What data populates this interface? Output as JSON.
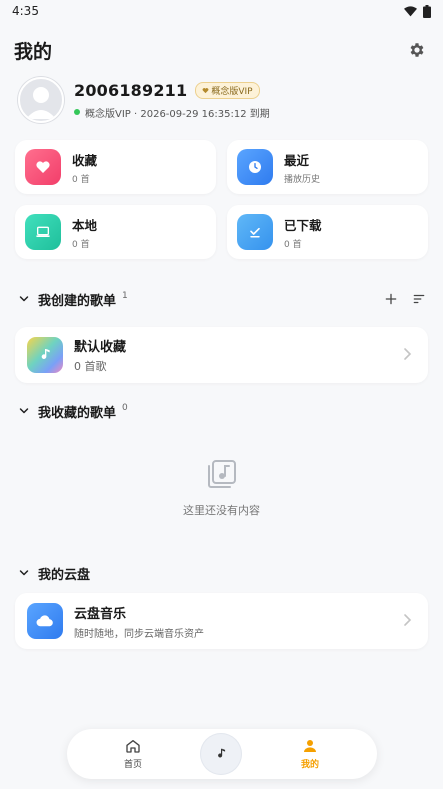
{
  "status_bar": {
    "time": "4:35"
  },
  "header": {
    "title": "我的"
  },
  "profile": {
    "username": "2006189211",
    "badge": "概念版VIP",
    "vip_status": "概念版VIP · 2026-09-29 16:35:12 到期"
  },
  "tiles": [
    {
      "title": "收藏",
      "sub": "0 首"
    },
    {
      "title": "最近",
      "sub": "播放历史"
    },
    {
      "title": "本地",
      "sub": "0 首"
    },
    {
      "title": "已下载",
      "sub": "0 首"
    }
  ],
  "created_playlists": {
    "title": "我创建的歌单",
    "count": "1",
    "items": [
      {
        "title": "默认收藏",
        "sub": "0 首歌"
      }
    ]
  },
  "collected_playlists": {
    "title": "我收藏的歌单",
    "count": "0",
    "empty_text": "这里还没有内容"
  },
  "cloud": {
    "title": "我的云盘",
    "item": {
      "title": "云盘音乐",
      "sub": "随时随地，同步云端音乐资产"
    }
  },
  "bottom_nav": {
    "home_label": "首页",
    "mine_label": "我的"
  },
  "colors": {
    "accent": "#f5a000",
    "favorite": "#f5577a",
    "recent": "#3d8ef7",
    "local": "#2fd0ad",
    "downloaded": "#4aa3f5",
    "cloud": "#3d8ef7"
  }
}
